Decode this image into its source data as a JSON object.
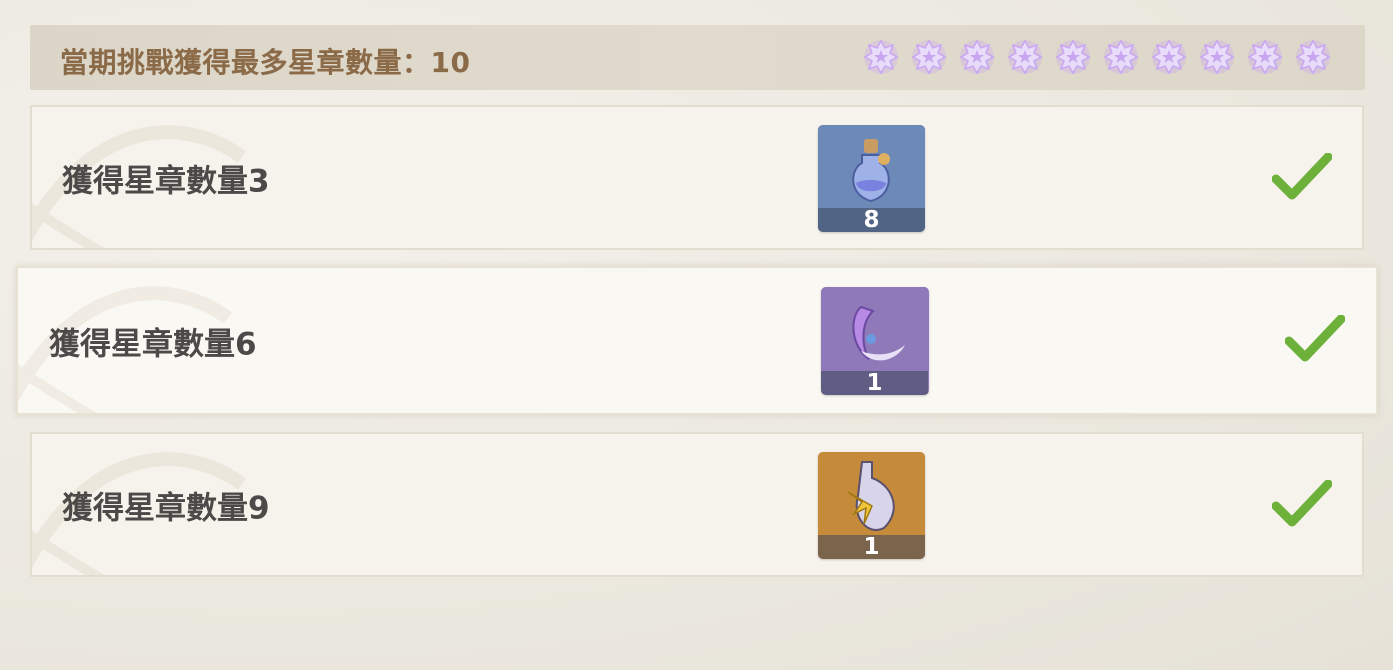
{
  "header": {
    "title": "當期挑戰獲得最多星章數量：10",
    "star_count": 10,
    "star_color": "#c9a6f0"
  },
  "rows": [
    {
      "label": "獲得星章數量3",
      "reward_icon": "potion-bottle-icon",
      "reward_count": "8",
      "reward_bg": "#6d89b8",
      "completed": true
    },
    {
      "label": "獲得星章數量6",
      "reward_icon": "crystal-ornament-icon",
      "reward_count": "1",
      "reward_bg": "#8f79b8",
      "completed": true
    },
    {
      "label": "獲得星章數量9",
      "reward_icon": "flower-vial-icon",
      "reward_count": "1",
      "reward_bg": "#c58a3a",
      "completed": true
    }
  ],
  "colors": {
    "check": "#6db03a",
    "header_text": "#8b6a48",
    "row_text": "#4c4a48"
  }
}
